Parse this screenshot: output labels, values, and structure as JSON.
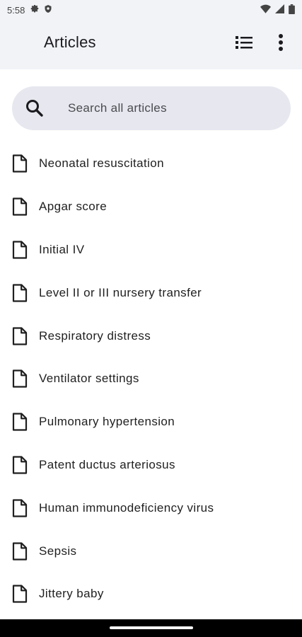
{
  "status_bar": {
    "time": "5:58",
    "left_icons": [
      "gear-icon",
      "shield-icon"
    ],
    "right_icons": [
      "wifi-icon",
      "cellular-signal-icon",
      "battery-icon"
    ]
  },
  "app_bar": {
    "title": "Articles",
    "actions": [
      "list-view-icon",
      "more-vert-icon"
    ]
  },
  "search": {
    "placeholder": "Search all articles"
  },
  "articles": [
    {
      "label": "Neonatal resuscitation"
    },
    {
      "label": "Apgar score"
    },
    {
      "label": "Initial IV"
    },
    {
      "label": "Level II or III nursery transfer"
    },
    {
      "label": "Respiratory distress"
    },
    {
      "label": "Ventilator settings"
    },
    {
      "label": "Pulmonary hypertension"
    },
    {
      "label": "Patent ductus arteriosus"
    },
    {
      "label": "Human immunodeficiency virus"
    },
    {
      "label": "Sepsis"
    },
    {
      "label": "Jittery baby"
    }
  ],
  "colors": {
    "header_background": "#f2f3f7",
    "search_background": "#e7e8ef",
    "text": "#1f1f1f"
  }
}
